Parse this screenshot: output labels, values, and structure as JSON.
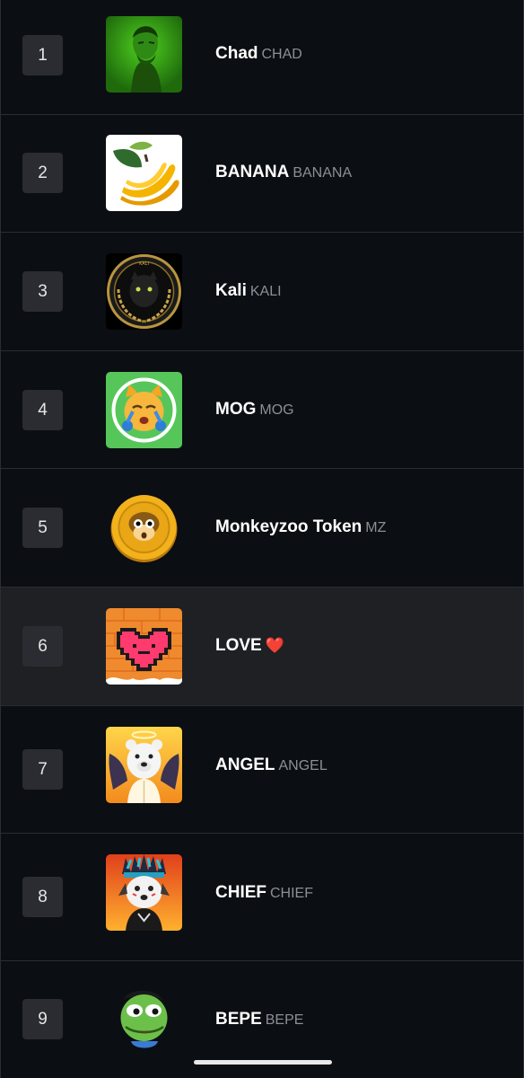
{
  "tokens": [
    {
      "rank": "1",
      "name": "Chad",
      "symbol": "CHAD",
      "logo": "chad-gigachad-logo"
    },
    {
      "rank": "2",
      "name": "BANANA",
      "symbol": "BANANA",
      "logo": "banana-logo"
    },
    {
      "rank": "3",
      "name": "Kali",
      "symbol": "KALI",
      "logo": "black-panther-laurel-logo"
    },
    {
      "rank": "4",
      "name": "MOG",
      "symbol": "MOG",
      "logo": "crying-cat-logo"
    },
    {
      "rank": "5",
      "name": "Monkeyzoo Token",
      "symbol": "MZ",
      "logo": "monkey-coin-logo"
    },
    {
      "rank": "6",
      "name": "LOVE",
      "symbol": "",
      "logo": "pixel-heart-logo",
      "emoji": "❤️",
      "emoji_icon": "red-heart-icon",
      "highlighted": true
    },
    {
      "rank": "7",
      "name": "ANGEL",
      "symbol": "ANGEL",
      "logo": "angel-bear-logo"
    },
    {
      "rank": "8",
      "name": "CHIEF",
      "symbol": "CHIEF",
      "logo": "chief-dog-logo"
    },
    {
      "rank": "9",
      "name": "BEPE",
      "symbol": "BEPE",
      "logo": "pepe-frog-logo"
    }
  ],
  "colors": {
    "background": "#0b0e12",
    "row_highlight": "#1e2024",
    "divider": "#2a2d33",
    "rank_badge": "#2a2c31",
    "symbol_text": "#8c8f95"
  }
}
